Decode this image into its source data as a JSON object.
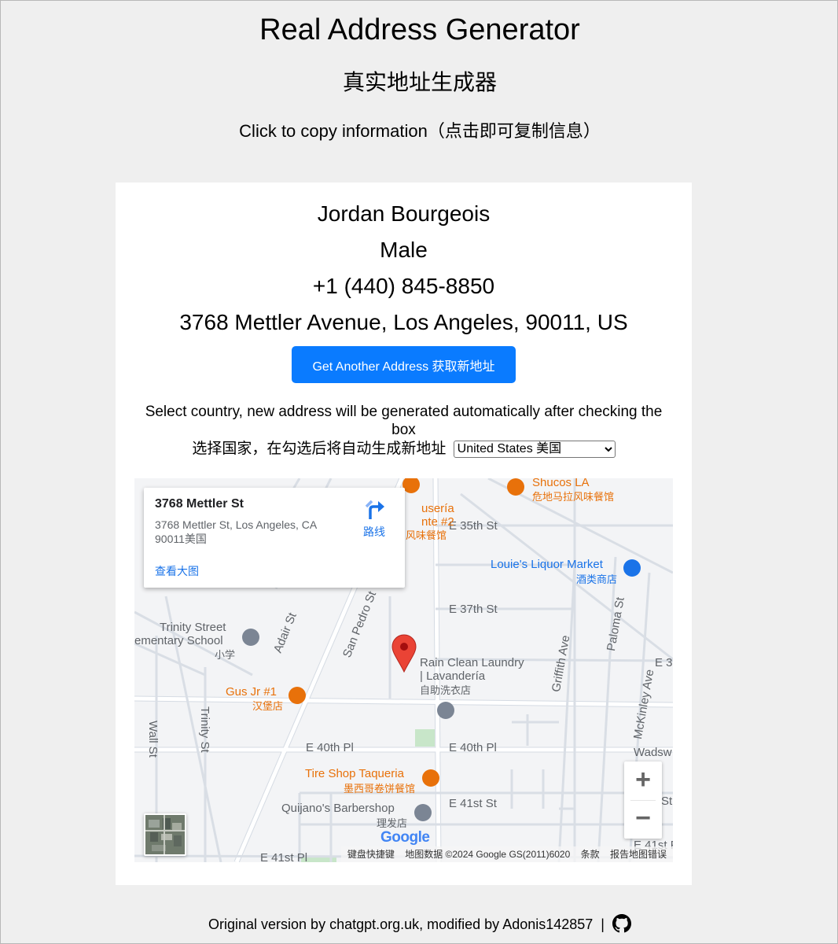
{
  "header": {
    "title": "Real Address Generator",
    "subtitle": "真实地址生成器",
    "copy_hint": "Click to copy information（点击即可复制信息）"
  },
  "person": {
    "name": "Jordan Bourgeois",
    "gender": "Male",
    "phone": "+1 (440) 845-8850",
    "address": "3768 Mettler Avenue, Los Angeles, 90011, US"
  },
  "actions": {
    "new_address_label": "Get Another Address 获取新地址"
  },
  "country": {
    "note": "Select country, new address will be generated automatically after checking the box",
    "label": "选择国家，在勾选后将自动生成新地址",
    "selected": "United States 美国"
  },
  "map": {
    "info_window": {
      "title": "3768 Mettler St",
      "address": "3768 Mettler St, Los Angeles, CA 90011美国",
      "directions_label": "路线",
      "view_larger_label": "查看大图"
    },
    "streets": {
      "e35": "E 35th St",
      "e37": "E 37th St",
      "e40a": "E 40th Pl",
      "e40b": "E 40th Pl",
      "e41": "E 41st St",
      "e41pl": "E 41st Pl",
      "e41p_right": "E 41st P",
      "adair": "Adair St",
      "sanpedro": "San Pedro St",
      "griffith": "Griffith Ave",
      "paloma": "Paloma St",
      "mckinley": "McKinley Ave",
      "wall": "Wall St",
      "trinity": "Trinity St",
      "e3_right": "E 3",
      "wadsw": "Wadsw",
      "st_partial": "St"
    },
    "places": {
      "shucos": "Shucos LA",
      "shucos_zh": "危地马拉风味餐馆",
      "louies": "Louie's Liquor Market",
      "louies_zh": "酒类商店",
      "trinity_school_1": "Trinity Street",
      "trinity_school_2": "ementary School",
      "trinity_school_zh": "小学",
      "rain_clean_1": "Rain Clean Laundry",
      "rain_clean_2": "| Lavandería",
      "rain_clean_zh": "自助洗衣店",
      "gus": "Gus Jr #1",
      "gus_zh": "汉堡店",
      "tire_shop": "Tire Shop Taqueria",
      "tire_shop_zh": "墨西哥卷饼餐馆",
      "quijano": "Quijano's Barbershop",
      "quijano_zh": "理发店",
      "taqueria_1": "usería",
      "taqueria_2": "nte #2",
      "taqueria_zh": "风味餐馆"
    },
    "zoom_in": "+",
    "zoom_out": "−",
    "google": "Google",
    "attribution": {
      "shortcuts": "键盘快捷键",
      "data": "地图数据 ©2024 Google GS(2011)6020",
      "terms": "条款",
      "report": "报告地图错误"
    },
    "colors": {
      "roads": "#ffffff",
      "road_outline": "#d5dbe3",
      "poi_orange": "#e8710a",
      "poi_blue": "#1a73e8",
      "pin": "#ea4335",
      "park": "#c8e6c9"
    }
  },
  "footer": {
    "text": "Original version by chatgpt.org.uk, modified by Adonis142857",
    "separator": "|",
    "icon": "github-icon"
  }
}
